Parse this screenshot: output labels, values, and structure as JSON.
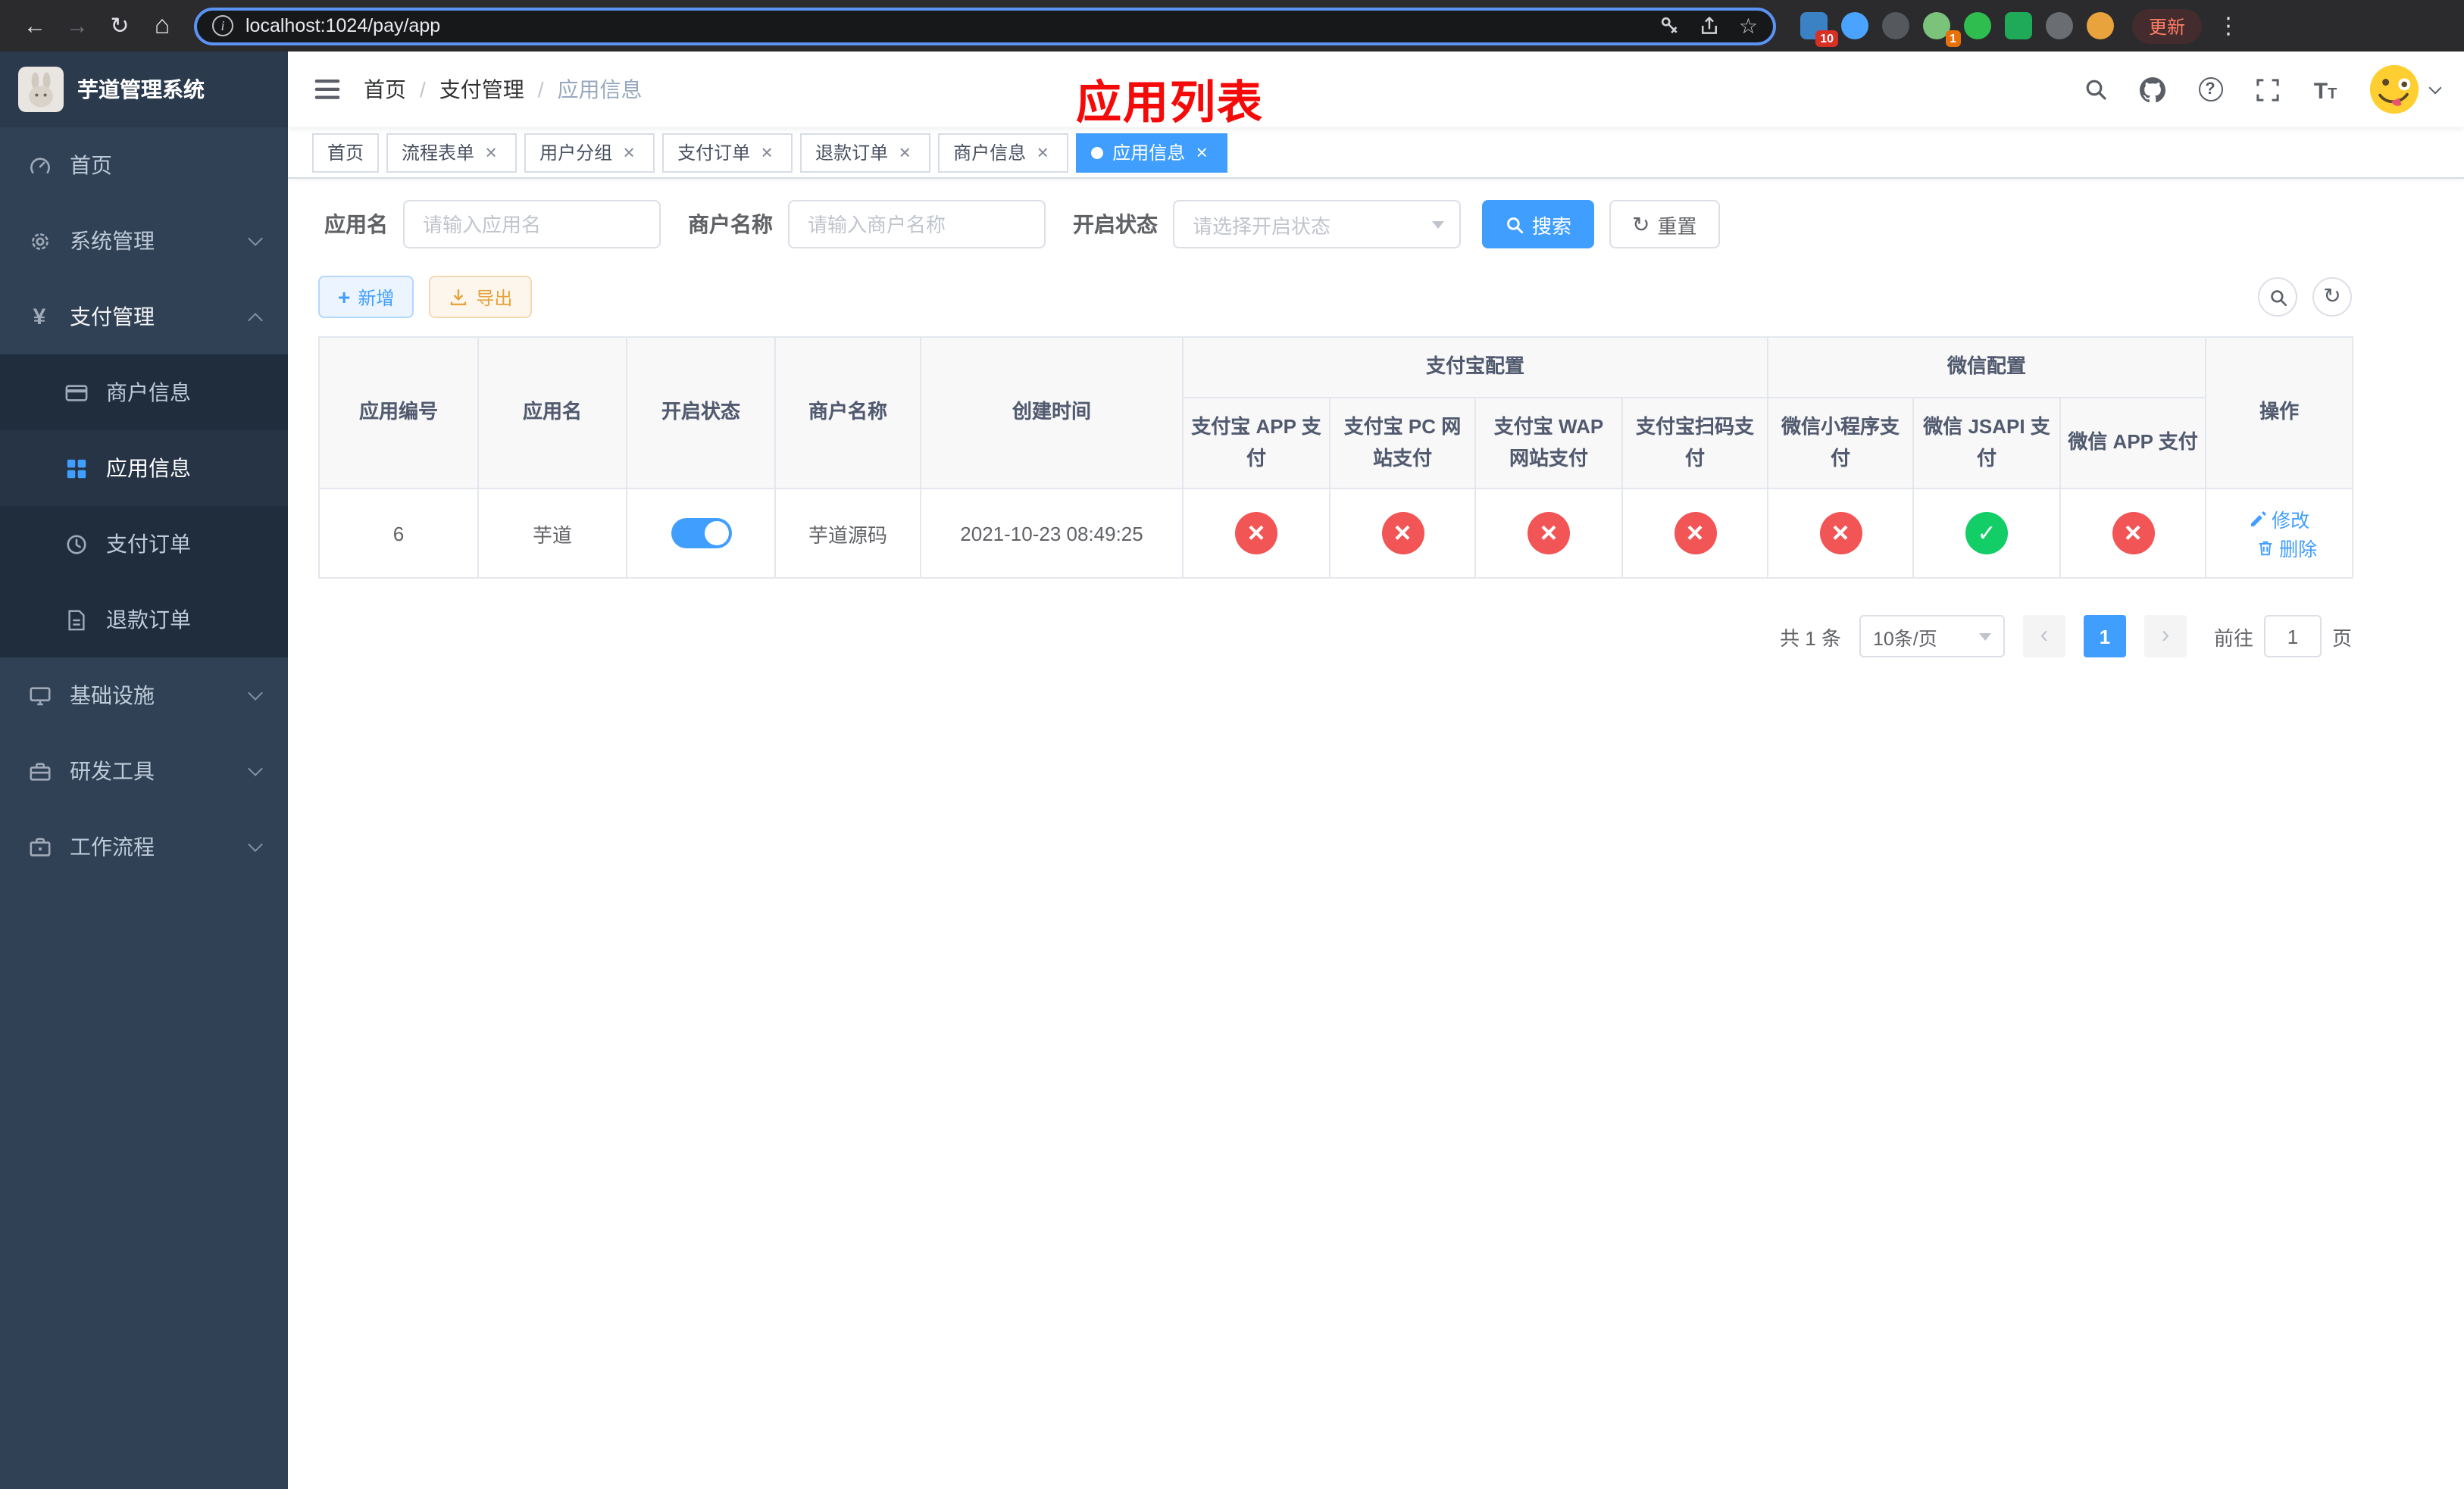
{
  "browser": {
    "url": "localhost:1024/pay/app",
    "update_label": "更新",
    "badge_extensions": "10",
    "badge_translate": "1"
  },
  "sidebar": {
    "title": "芋道管理系统",
    "home": "首页",
    "system": "系统管理",
    "payment": "支付管理",
    "merchant_info": "商户信息",
    "app_info": "应用信息",
    "pay_order": "支付订单",
    "refund_order": "退款订单",
    "infra": "基础设施",
    "dev_tools": "研发工具",
    "workflow": "工作流程"
  },
  "breadcrumb": {
    "home": "首页",
    "section": "支付管理",
    "current": "应用信息"
  },
  "page_title": "应用列表",
  "tabs": [
    {
      "label": "首页",
      "closable": false,
      "active": false
    },
    {
      "label": "流程表单",
      "closable": true,
      "active": false
    },
    {
      "label": "用户分组",
      "closable": true,
      "active": false
    },
    {
      "label": "支付订单",
      "closable": true,
      "active": false
    },
    {
      "label": "退款订单",
      "closable": true,
      "active": false
    },
    {
      "label": "商户信息",
      "closable": true,
      "active": false
    },
    {
      "label": "应用信息",
      "closable": true,
      "active": true
    }
  ],
  "filters": {
    "app_name_label": "应用名",
    "app_name_placeholder": "请输入应用名",
    "merchant_label": "商户名称",
    "merchant_placeholder": "请输入商户名称",
    "status_label": "开启状态",
    "status_placeholder": "请选择开启状态",
    "search_label": "搜索",
    "reset_label": "重置"
  },
  "toolbar": {
    "add": "新增",
    "export": "导出"
  },
  "table": {
    "col_id": "应用编号",
    "col_name": "应用名",
    "col_status": "开启状态",
    "col_merchant": "商户名称",
    "col_created": "创建时间",
    "col_actions": "操作",
    "group_alipay": "支付宝配置",
    "group_wechat": "微信配置",
    "col_alipay_app": "支付宝 APP 支付",
    "col_alipay_pc": "支付宝 PC 网站支付",
    "col_alipay_wap": "支付宝 WAP 网站支付",
    "col_alipay_scan": "支付宝扫码支付",
    "col_wx_mini": "微信小程序支付",
    "col_wx_jsapi": "微信 JSAPI 支付",
    "col_wx_app": "微信 APP 支付",
    "rows": [
      {
        "id": "6",
        "name": "芋道",
        "status": "on",
        "merchant": "芋道源码",
        "created_at": "2021-10-23 08:49:25",
        "alipay_app": "no",
        "alipay_pc": "no",
        "alipay_wap": "no",
        "alipay_scan": "no",
        "wx_mini": "no",
        "wx_jsapi": "yes",
        "wx_app": "no",
        "edit": "修改",
        "delete": "删除"
      }
    ]
  },
  "pagination": {
    "total": "共 1 条",
    "page_size": "10条/页",
    "page": "1",
    "goto": "前往",
    "goto_value": "1",
    "unit": "页"
  },
  "colors": {
    "accent": "#409eff",
    "success": "#13ce66",
    "danger": "#f25555",
    "warning": "#e6a23c",
    "title_red": "#f50a0a",
    "sidebar_bg": "#304156",
    "submenu_bg": "#1f2d3d"
  }
}
